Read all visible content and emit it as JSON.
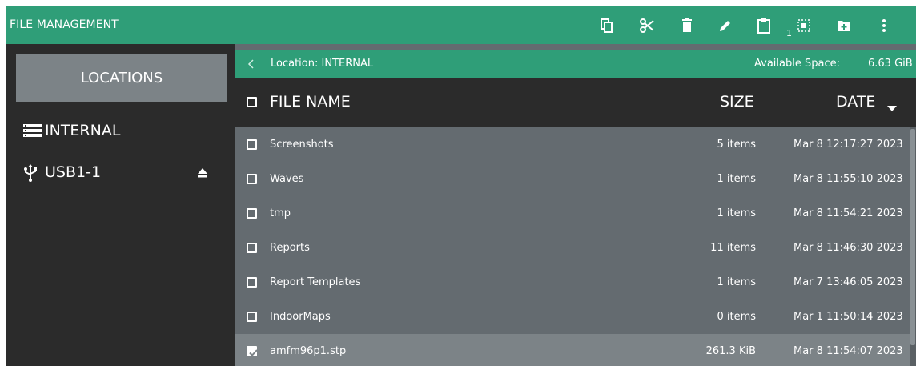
{
  "app": {
    "title": "FILE MANAGEMENT"
  },
  "toolbar": {
    "icons": [
      "copy-icon",
      "cut-icon",
      "delete-icon",
      "rename-icon",
      "paste-icon",
      "select-all-icon",
      "new-folder-icon",
      "more-icon"
    ],
    "clipboard_count": "1",
    "accent_color": "#2f9e78"
  },
  "sidebar": {
    "header": "LOCATIONS",
    "items": [
      {
        "label": "INTERNAL",
        "icon": "storage-icon"
      },
      {
        "label": "USB1-1",
        "icon": "usb-icon",
        "eject": true
      }
    ]
  },
  "location_bar": {
    "location": "Location: INTERNAL",
    "space_label": "Available Space:",
    "space_value": "6.63 GiB"
  },
  "columns": {
    "name": "FILE NAME",
    "size": "SIZE",
    "date": "DATE",
    "sort": "descending"
  },
  "files": [
    {
      "name": "Screenshots",
      "size": "5 items",
      "date": "Mar 8 12:17:27 2023",
      "checked": false
    },
    {
      "name": "Waves",
      "size": "1 items",
      "date": "Mar 8 11:55:10 2023",
      "checked": false
    },
    {
      "name": "tmp",
      "size": "1 items",
      "date": "Mar 8 11:54:21 2023",
      "checked": false
    },
    {
      "name": "Reports",
      "size": "11 items",
      "date": "Mar 8 11:46:30 2023",
      "checked": false
    },
    {
      "name": "Report Templates",
      "size": "1 items",
      "date": "Mar 7 13:46:05 2023",
      "checked": false
    },
    {
      "name": "IndoorMaps",
      "size": "0 items",
      "date": "Mar 1 11:50:14 2023",
      "checked": false
    },
    {
      "name": "amfm96p1.stp",
      "size": "261.3 KiB",
      "date": "Mar 8 11:54:07 2023",
      "checked": true
    }
  ]
}
